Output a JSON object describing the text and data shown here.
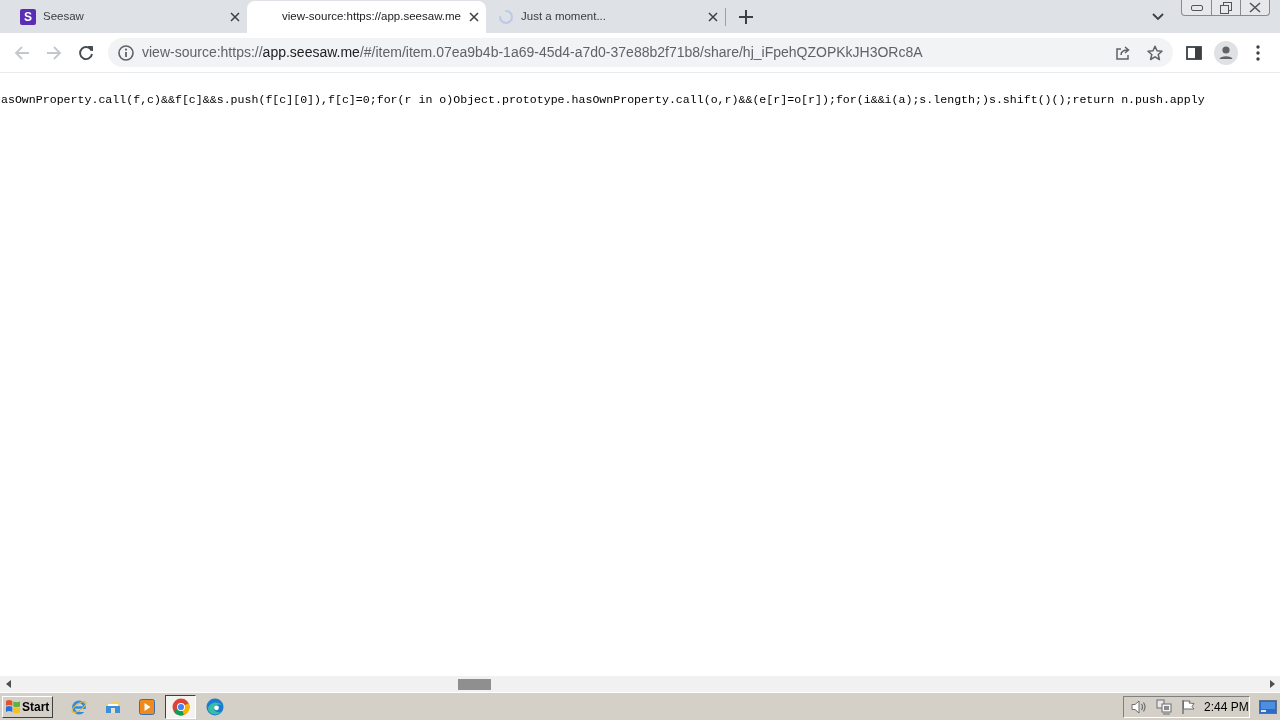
{
  "tabs": [
    {
      "kind": "site",
      "icon_text": "S",
      "title": "Seesaw",
      "selected": false
    },
    {
      "kind": "blank",
      "title": "view-source:https://app.seesaw.me",
      "selected": true
    },
    {
      "kind": "loading",
      "title": "Just a moment...",
      "selected": false
    }
  ],
  "nav_buttons": [
    {
      "kind": "back",
      "disabled": true
    },
    {
      "kind": "forward",
      "disabled": true
    },
    {
      "kind": "reload",
      "disabled": false
    }
  ],
  "address_bar": {
    "scheme": "view-source:https://",
    "host": "app.seesaw.me",
    "path": "/#/item/item.07ea9b4b-1a69-45d4-a7d0-37e88b2f71b8/share/hj_iFpehQZOPKkJH3ORc8A"
  },
  "source_lines": [
    "asOwnProperty.call(f,c)&&f[c]&&s.push(f[c][0]),f[c]=0;for(r in o)Object.prototype.hasOwnProperty.call(o,r)&&(e[r]=o[r]);for(i&&i(a);s.length;)s.shift()();return n.push.apply"
  ],
  "taskbar": {
    "start_label": "Start",
    "apps": [
      {
        "kind": "ie",
        "active": false
      },
      {
        "kind": "folder",
        "active": false
      },
      {
        "kind": "media",
        "active": false
      },
      {
        "kind": "chrome",
        "active": true
      },
      {
        "kind": "edge",
        "active": false
      }
    ],
    "clock": "2:44 PM"
  }
}
